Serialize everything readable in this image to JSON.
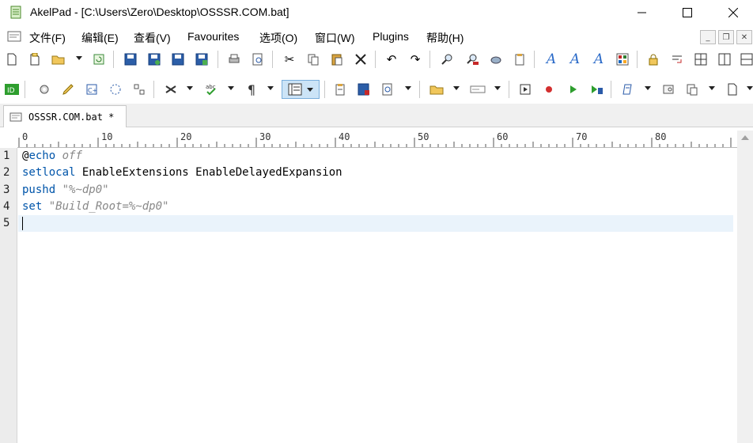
{
  "window": {
    "title": "AkelPad - [C:\\Users\\Zero\\Desktop\\OSSSR.COM.bat]",
    "icon": "notepad-icon"
  },
  "menu": {
    "items": [
      {
        "label": "文件(F)"
      },
      {
        "label": "编辑(E)"
      },
      {
        "label": "查看(V)"
      },
      {
        "label": "Favourites"
      },
      {
        "label": "选项(O)"
      },
      {
        "label": "窗口(W)"
      },
      {
        "label": "Plugins"
      },
      {
        "label": "帮助(H)"
      }
    ]
  },
  "tab": {
    "label": "OSSSR.COM.bat *"
  },
  "ruler": {
    "marks": [
      "0",
      "10",
      "20",
      "30",
      "40",
      "50",
      "60",
      "70",
      "80"
    ]
  },
  "editor": {
    "line_numbers": [
      "1",
      "2",
      "3",
      "4",
      "5"
    ],
    "lines": [
      {
        "at": "@",
        "kw": "echo",
        "rest": " ",
        "str": "off"
      },
      {
        "kw": "setlocal",
        "rest": " EnableExtensions EnableDelayedExpansion",
        "str": ""
      },
      {
        "kw": "pushd",
        "rest": " ",
        "str": "\"%~dp0\""
      },
      {
        "kw": "set",
        "rest": " ",
        "str": "\"Build_Root=%~dp0\""
      },
      {
        "kw": "",
        "rest": "",
        "str": ""
      }
    ]
  },
  "colors": {
    "keyword": "#0055aa",
    "string": "#888888",
    "current_line": "#eaf3fb"
  }
}
